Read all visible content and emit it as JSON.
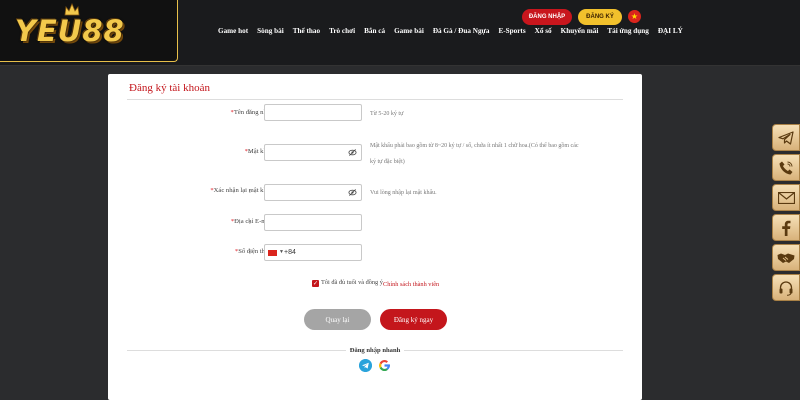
{
  "header": {
    "logo_text": "YEU88",
    "login_label": "ĐĂNG NHẬP",
    "register_label": "ĐĂNG KÝ",
    "nav": [
      "Game hot",
      "Sòng bài",
      "Thể thao",
      "Trò chơi",
      "Bắn cá",
      "Game bài",
      "Đá Gà / Đua Ngựa",
      "E-Sports",
      "Xổ số",
      "Khuyến mãi",
      "Tải ứng dụng",
      "ĐẠI LÝ"
    ]
  },
  "form": {
    "title": "Đăng ký tài khoản",
    "username": {
      "label": "Tên đăng nhập",
      "hint": "Từ 5-20 ký tự"
    },
    "password": {
      "label": "Mật khẩu",
      "hint_line1": "Mật khẩu phải bao gồm từ 8~20 ký tự / số, chứa ít nhất 1 chữ hoa.(Có thể bao gồm các",
      "hint_line2": "ký tự đặc biệt)"
    },
    "confirm_password": {
      "label": "Xác nhận lại mật khẩu",
      "hint": "Vui lòng nhập lại mật khẩu."
    },
    "email": {
      "label": "Địa chỉ E-mail"
    },
    "phone": {
      "label": "Số điện thoại",
      "code": "+84"
    },
    "agree_text": "Tôi đã đủ tuổi và đồng ý",
    "agree_link": "Chính sách thành viên",
    "back_label": "Quay lại",
    "submit_label": "Đăng ký ngay",
    "quick_login": "Đăng nhập nhanh"
  },
  "colors": {
    "accent_red": "#c4161c",
    "gold": "#f2c12c",
    "background": "#2b2c2e"
  },
  "icons": [
    "telegram-icon",
    "phone-icon",
    "mail-icon",
    "facebook-icon",
    "handshake-icon",
    "headset-icon"
  ]
}
